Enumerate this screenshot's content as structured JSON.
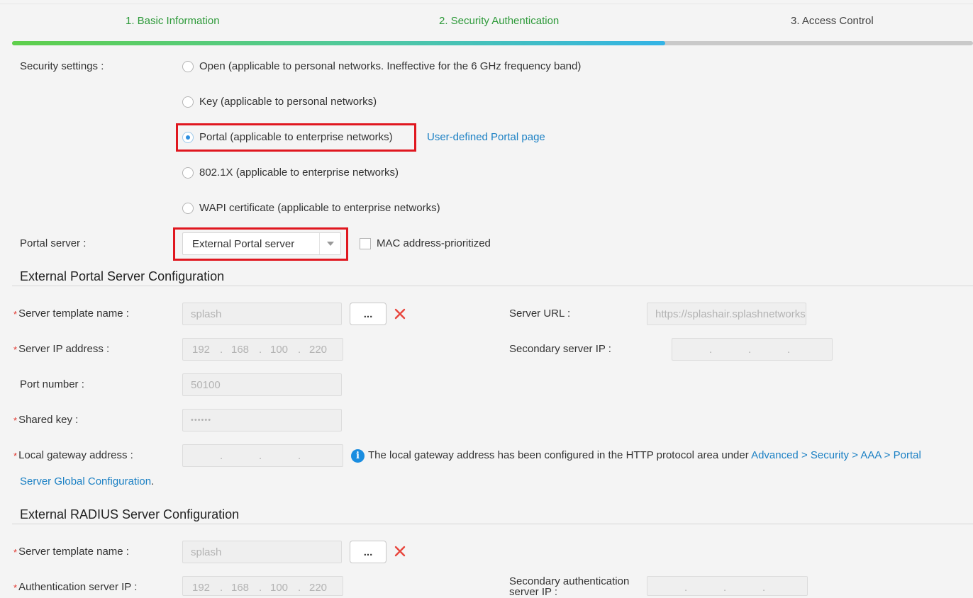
{
  "steps": [
    {
      "label": "1. Basic Information"
    },
    {
      "label": "2. Security Authentication"
    },
    {
      "label": "3. Access Control"
    }
  ],
  "progress_fraction": 0.68,
  "security": {
    "label": "Security settings :",
    "options": [
      {
        "label": "Open (applicable to personal networks. Ineffective for the 6 GHz frequency band)",
        "checked": false
      },
      {
        "label": "Key (applicable to personal networks)",
        "checked": false
      },
      {
        "label": "Portal (applicable to enterprise networks)",
        "checked": true
      },
      {
        "label": "802.1X (applicable to enterprise networks)",
        "checked": false
      },
      {
        "label": "WAPI certificate (applicable to enterprise networks)",
        "checked": false
      }
    ],
    "portal_link": "User-defined Portal page"
  },
  "portal_server": {
    "label": "Portal server :",
    "selected": "External Portal server",
    "mac_prioritized_label": "MAC address-prioritized",
    "mac_prioritized_checked": false
  },
  "external_portal": {
    "title": "External Portal Server Configuration",
    "template_label": "Server template name :",
    "template_value": "splash",
    "browse_label": "...",
    "server_ip_label": "Server IP address :",
    "server_ip": [
      "192",
      "168",
      "100",
      "220"
    ],
    "port_label": "Port number :",
    "port_value": "50100",
    "shared_key_label": "Shared key :",
    "shared_key_value": "••••••",
    "gateway_label": "Local gateway address :",
    "gateway_note": "The local gateway address has been configured in the HTTP protocol area under",
    "gateway_link_1": "Advanced > Security > AAA > Portal",
    "gateway_link_2": "Server Global Configuration",
    "gateway_period": ".",
    "server_url_label": "Server URL :",
    "server_url_value": "https://splashair.splashnetworks",
    "secondary_ip_label": "Secondary server IP :"
  },
  "external_radius": {
    "title": "External RADIUS Server Configuration",
    "template_label": "Server template name :",
    "template_value": "splash",
    "browse_label": "...",
    "auth_ip_label": "Authentication server IP :",
    "auth_ip": [
      "192",
      "168",
      "100",
      "220"
    ],
    "secondary_auth_label_1": "Secondary authentication",
    "secondary_auth_label_2": "server IP :"
  },
  "colors": {
    "success": "#2e9a3a",
    "link": "#1b80c4",
    "highlight": "#e0171f",
    "required": "#e0332b"
  }
}
